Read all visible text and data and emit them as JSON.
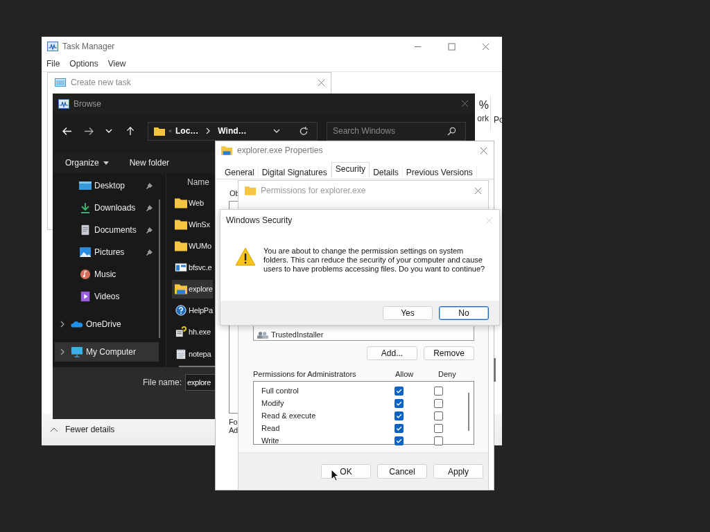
{
  "task_manager": {
    "title": "Task Manager",
    "menu": [
      "File",
      "Options",
      "View"
    ],
    "column_fragments": [
      "%",
      "ork",
      "Po"
    ],
    "footer": "Fewer details"
  },
  "create_task": {
    "title": "Create new task"
  },
  "browse": {
    "title": "Browse",
    "path_prefix": "«",
    "path": [
      "Loc…",
      "Wind…"
    ],
    "search": {
      "placeholder": "Search Windows"
    },
    "toolbar": [
      "Organize",
      "New folder"
    ],
    "sidebar": [
      {
        "label": "Desktop",
        "kind": "desktop",
        "pinned": true,
        "expandable": false,
        "selected": false
      },
      {
        "label": "Downloads",
        "kind": "downloads",
        "pinned": true,
        "expandable": false,
        "selected": false
      },
      {
        "label": "Documents",
        "kind": "documents",
        "pinned": true,
        "expandable": false,
        "selected": false
      },
      {
        "label": "Pictures",
        "kind": "pictures",
        "pinned": true,
        "expandable": false,
        "selected": false
      },
      {
        "label": "Music",
        "kind": "music",
        "pinned": false,
        "expandable": false,
        "selected": false
      },
      {
        "label": "Videos",
        "kind": "videos",
        "pinned": false,
        "expandable": false,
        "selected": false
      },
      {
        "label": "OneDrive",
        "kind": "cloud",
        "pinned": false,
        "expandable": true,
        "selected": false
      },
      {
        "label": "My Computer",
        "kind": "computer",
        "pinned": false,
        "expandable": true,
        "selected": true
      }
    ],
    "files_header": "Name",
    "files": [
      {
        "name": "Web",
        "kind": "folder",
        "selected": false
      },
      {
        "name": "WinSx",
        "kind": "folder",
        "selected": false
      },
      {
        "name": "WUMo",
        "kind": "folder",
        "selected": false
      },
      {
        "name": "bfsvc.e",
        "kind": "app",
        "selected": false
      },
      {
        "name": "explore",
        "kind": "explorer",
        "selected": true
      },
      {
        "name": "HelpPa",
        "kind": "help",
        "selected": false
      },
      {
        "name": "hh.exe",
        "kind": "helpdoc",
        "selected": false
      },
      {
        "name": "notepa",
        "kind": "notepad",
        "selected": false
      }
    ],
    "file_name": {
      "label": "File name:",
      "value": "explore"
    }
  },
  "properties": {
    "title": "explorer.exe Properties",
    "tabs": [
      {
        "label": "General",
        "selected": false
      },
      {
        "label": "Digital Signatures",
        "selected": false
      },
      {
        "label": "Security",
        "selected": true
      },
      {
        "label": "Details",
        "selected": false
      },
      {
        "label": "Previous Versions",
        "selected": false
      }
    ],
    "fragments": [
      "Ob",
      "Fo",
      "Ad"
    ]
  },
  "permissions": {
    "title": "Permissions for explorer.exe",
    "principal": "TrustedInstaller",
    "list_buttons": [
      "Add...",
      "Remove"
    ],
    "header": "Permissions for Administrators",
    "allow_header": "Allow",
    "deny_header": "Deny",
    "rows": [
      {
        "label": "Full control",
        "allow": true,
        "deny": false
      },
      {
        "label": "Modify",
        "allow": true,
        "deny": false
      },
      {
        "label": "Read & execute",
        "allow": true,
        "deny": false
      },
      {
        "label": "Read",
        "allow": true,
        "deny": false
      },
      {
        "label": "Write",
        "allow": true,
        "deny": false
      }
    ],
    "buttons": [
      "OK",
      "Cancel",
      "Apply"
    ]
  },
  "security": {
    "title": "Windows Security",
    "message": "You are about to change the permission settings on system folders. This can reduce the security of your computer and cause users to have problems accessing files. Do you want to continue?",
    "buttons": [
      {
        "label": "Yes",
        "default": false
      },
      {
        "label": "No",
        "default": true
      }
    ]
  }
}
